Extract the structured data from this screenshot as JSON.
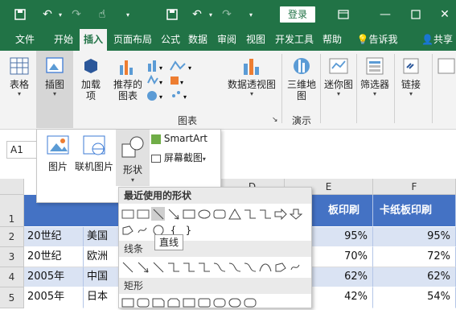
{
  "titlebar": {
    "login_label": "登录"
  },
  "menu": [
    {
      "label": "文件"
    },
    {
      "label": "开始"
    },
    {
      "label": "插入",
      "active": true
    },
    {
      "label": "页面布局"
    },
    {
      "label": "公式"
    },
    {
      "label": "数据"
    },
    {
      "label": "审阅"
    },
    {
      "label": "视图"
    },
    {
      "label": "开发工具"
    },
    {
      "label": "帮助"
    },
    {
      "label": "告诉我"
    },
    {
      "label": "共享"
    }
  ],
  "ribbon": {
    "table_label": "表格",
    "illustrations_label": "插图",
    "addins_label": "加载\n项",
    "recommended_charts_label": "推荐的\n图表",
    "pivot_chart_label": "数据透视图",
    "map3d_label": "三维地\n图",
    "sparkline_label": "迷你图",
    "slicer_label": "筛选器",
    "link_label": "链接",
    "group_charts": "图表",
    "group_tours": "演示"
  },
  "illustrations_menu": {
    "picture": "图片",
    "online_picture": "联机图片",
    "shapes": "形状",
    "smartart": "SmartArt",
    "screenshot": "屏幕截图"
  },
  "namebox": "A1",
  "columns": [
    "D",
    "E",
    "F"
  ],
  "rows": [
    {
      "num": "1",
      "a": "",
      "b": "",
      "e": "板印刷",
      "f": "卡纸板印刷"
    },
    {
      "num": "2",
      "a": "20世纪",
      "b": "美国",
      "e": "95%",
      "f": "95%"
    },
    {
      "num": "3",
      "a": "20世纪",
      "b": "欧洲",
      "e": "70%",
      "f": "72%"
    },
    {
      "num": "4",
      "a": "2005年",
      "b": "中国",
      "e": "62%",
      "f": "62%"
    },
    {
      "num": "5",
      "a": "2005年",
      "b": "日本",
      "e": "42%",
      "f": "54%"
    }
  ],
  "shape_panel": {
    "recent_label": "最近使用的形状",
    "lines_label": "线条",
    "rect_label": "矩形",
    "tooltip": "直线"
  },
  "colors": {
    "excel_green": "#217346",
    "header_blue": "#4472c4",
    "row_blue": "#dae3f3"
  }
}
